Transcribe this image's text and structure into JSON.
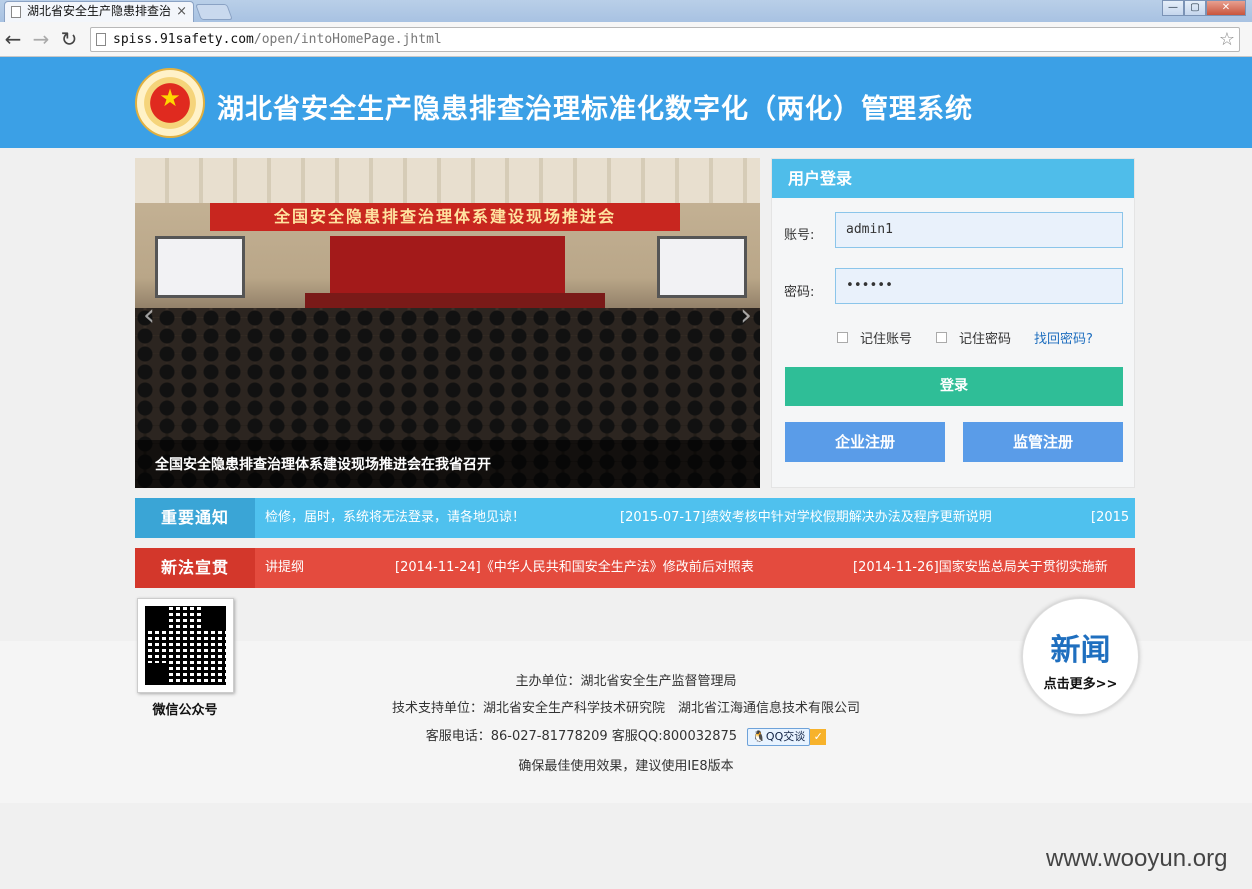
{
  "browser": {
    "tab_title": "湖北省安全生产隐患排查治",
    "tab_close": "×",
    "url_host": "spiss.91safety.com",
    "url_path": "/open/intoHomePage.jhtml",
    "window_buttons": [
      "—",
      "▢",
      "✕"
    ]
  },
  "header": {
    "title": "湖北省安全生产隐患排查治理标准化数字化（两化）管理系统"
  },
  "banner": {
    "scene_banner_text": "全国安全隐患排查治理体系建设现场推进会",
    "caption": "全国安全隐患排查治理体系建设现场推进会在我省召开",
    "prev_arrow": "‹",
    "next_arrow": "›"
  },
  "login": {
    "title": "用户登录",
    "account_label": "账号:",
    "account_value": "admin1",
    "password_label": "密码:",
    "password_value": "••••••",
    "remember_account": "记住账号",
    "remember_password": "记住密码",
    "forgot_link": "找回密码?",
    "login_button": "登录",
    "enterprise_register": "企业注册",
    "supervisor_register": "监管注册"
  },
  "notices": {
    "important_label": "重要通知",
    "important_items": [
      "检修，届时，系统将无法登录，请各地见谅！",
      "[2015-07-17]绩效考核中针对学校假期解决办法及程序更新说明",
      "[2015"
    ],
    "newlaw_label": "新法宣贯",
    "newlaw_items": [
      "讲提纲",
      "[2014-11-24]《中华人民共和国安全生产法》修改前后对照表",
      "[2014-11-26]国家安监总局关于贯彻实施新"
    ]
  },
  "footer": {
    "qr_label": "微信公众号",
    "host_unit": "主办单位：湖北省安全生产监督管理局",
    "tech_support": "技术支持单位：湖北省安全生产科学技术研究院　湖北省江海通信息技术有限公司",
    "service_phone": "客服电话：86-027-81778209 客服QQ:800032875",
    "qq_button": "QQ交谈",
    "browser_tip": "确保最佳使用效果，建议使用IE8版本",
    "news_title": "新闻",
    "news_more": "点击更多>>"
  },
  "watermark": "www.wooyun.org",
  "colors": {
    "header_bg": "#3ba0e6",
    "login_head": "#4fbdea",
    "login_button": "#2fbe97",
    "register_button": "#5a9ce8",
    "important_bar": "#4fc1ee",
    "newlaw_bar": "#e44b3e"
  }
}
